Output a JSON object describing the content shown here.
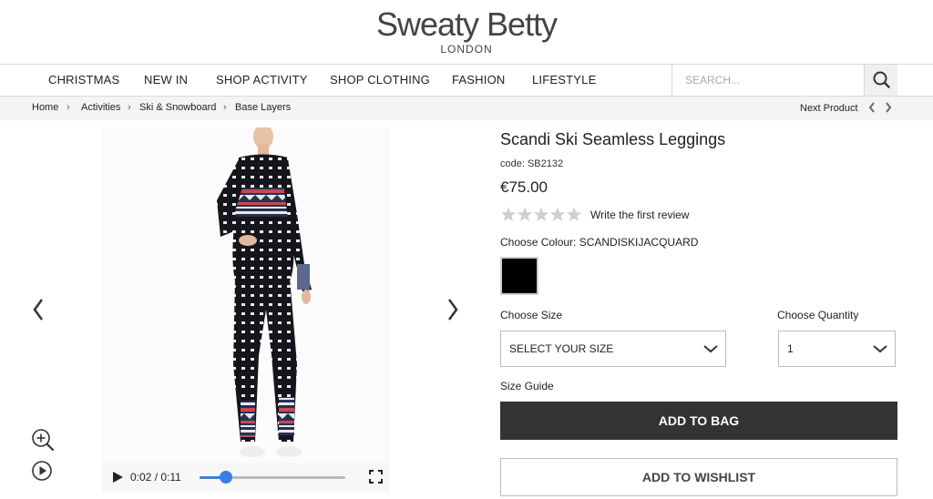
{
  "header": {
    "logo_main": "Sweaty Betty",
    "logo_sub": "LONDON"
  },
  "nav": {
    "items": [
      {
        "label": "CHRISTMAS"
      },
      {
        "label": "NEW IN"
      },
      {
        "label": "SHOP ACTIVITY"
      },
      {
        "label": "SHOP CLOTHING"
      },
      {
        "label": "FASHION"
      },
      {
        "label": "LIFESTYLE"
      }
    ],
    "search_placeholder": "SEARCH...",
    "search_icon": "search-icon"
  },
  "breadcrumb": {
    "items": [
      "Home",
      "Activities",
      "Ski & Snowboard",
      "Base Layers"
    ],
    "separator": "›",
    "next_product": "Next Product"
  },
  "gallery": {
    "prev_icon": "chevron-left-icon",
    "next_icon": "chevron-right-icon",
    "zoom_icon": "zoom-in-icon",
    "play_icon": "play-circle-icon",
    "video": {
      "time": "0:02 / 0:11",
      "progress": 0.18,
      "play_icon": "play-icon",
      "fullscreen_icon": "fullscreen-icon",
      "accent": "#3b7fe0"
    }
  },
  "product": {
    "title": "Scandi Ski Seamless Leggings",
    "code": "code: SB2132",
    "price": "€75.00",
    "rating": 0,
    "rating_max": 5,
    "review_link": "Write the first review",
    "colour_label": "Choose Colour: SCANDISKIJACQUARD",
    "swatch_color": "#000000",
    "size_label": "Choose Size",
    "size_value": "SELECT YOUR SIZE",
    "quantity_label": "Choose Quantity",
    "quantity_value": "1",
    "size_guide": "Size Guide",
    "add_to_bag": "ADD TO BAG",
    "add_to_wishlist": "ADD TO WISHLIST"
  },
  "colors": {
    "button_dark": "#333333",
    "breadcrumb_bg": "#f4f4f4",
    "star_empty": "#cfcfcf"
  }
}
